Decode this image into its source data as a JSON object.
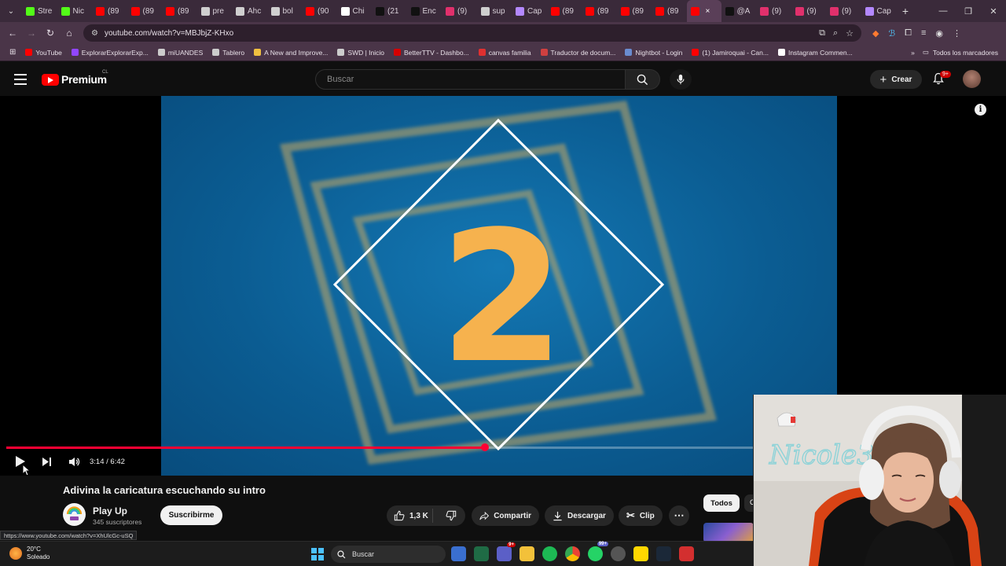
{
  "browser": {
    "tabs": [
      {
        "label": "Stre",
        "color": "#53fc18"
      },
      {
        "label": "Nic",
        "color": "#53fc18"
      },
      {
        "label": "(89",
        "color": "#ff0000"
      },
      {
        "label": "(89",
        "color": "#ff0000"
      },
      {
        "label": "(89",
        "color": "#ff0000"
      },
      {
        "label": "pre",
        "color": "#cfcfcf"
      },
      {
        "label": "Ahc",
        "color": "#cfcfcf"
      },
      {
        "label": "bol",
        "color": "#cfcfcf"
      },
      {
        "label": "(90",
        "color": "#ff0000"
      },
      {
        "label": "Chi",
        "color": "#ffffff"
      },
      {
        "label": "(21",
        "color": "#111111"
      },
      {
        "label": "Enc",
        "color": "#111111"
      },
      {
        "label": "(9)",
        "color": "#e1306c"
      },
      {
        "label": "sup",
        "color": "#cfcfcf"
      },
      {
        "label": "Cap",
        "color": "#b388ff"
      },
      {
        "label": "(89",
        "color": "#ff0000"
      },
      {
        "label": "(89",
        "color": "#ff0000"
      },
      {
        "label": "(89",
        "color": "#ff0000"
      },
      {
        "label": "(89",
        "color": "#ff0000"
      },
      {
        "label": "",
        "color": "#ff0000",
        "active": true
      },
      {
        "label": "@A",
        "color": "#111111"
      },
      {
        "label": "(9)",
        "color": "#e1306c"
      },
      {
        "label": "(9)",
        "color": "#e1306c"
      },
      {
        "label": "(9)",
        "color": "#e1306c"
      },
      {
        "label": "Cap",
        "color": "#b388ff"
      }
    ],
    "active_tab_close": "×",
    "new_tab": "+",
    "url": "youtube.com/watch?v=MBJbjZ-KHxo",
    "bookmarks": [
      {
        "label": "YouTube",
        "color": "#ff0000"
      },
      {
        "label": "ExplorarExplorarExp...",
        "color": "#9146ff"
      },
      {
        "label": "miUANDES",
        "color": "#cccccc"
      },
      {
        "label": "Tablero",
        "color": "#cccccc"
      },
      {
        "label": "A New and Improve...",
        "color": "#f0c040"
      },
      {
        "label": "SWD | Inicio",
        "color": "#cccccc"
      },
      {
        "label": "BetterTTV - Dashbo...",
        "color": "#d50000"
      },
      {
        "label": "canvas familia",
        "color": "#e03030"
      },
      {
        "label": "Traductor de docum...",
        "color": "#d04040"
      },
      {
        "label": "Nightbot - Login",
        "color": "#6a8cd0"
      },
      {
        "label": "(1) Jamiroquai - Can...",
        "color": "#ff0000"
      },
      {
        "label": "Instagram Commen...",
        "color": "#ffffff"
      }
    ],
    "bookmarks_more": "»",
    "all_bookmarks": "Todos los marcadores",
    "status_url": "https://www.youtube.com/watch?v=XhUlcGc-uSQ"
  },
  "youtube": {
    "logo_text": "Premium",
    "country": "CL",
    "search_placeholder": "Buscar",
    "create_label": "Crear",
    "notifications_badge": "9+",
    "video": {
      "big_number": "2",
      "current_time": "3:14",
      "duration": "6:42",
      "time_display": "3:14 / 6:42",
      "progress": 0.482
    },
    "title": "Adivina la caricatura escuchando su intro",
    "channel": {
      "name": "Play Up",
      "subscribers": "345 suscriptores"
    },
    "subscribe_label": "Suscribirme",
    "like_count": "1,3 K",
    "share_label": "Compartir",
    "download_label": "Descargar",
    "clip_label": "Clip",
    "chips": [
      "Todos",
      "C"
    ]
  },
  "taskbar": {
    "temperature": "20°C",
    "weather": "Soleado",
    "search_label": "Buscar",
    "badge_teams": "9+",
    "badge_whatsapp": "99+"
  },
  "webcam": {
    "sign_text": "Nicole3e"
  }
}
